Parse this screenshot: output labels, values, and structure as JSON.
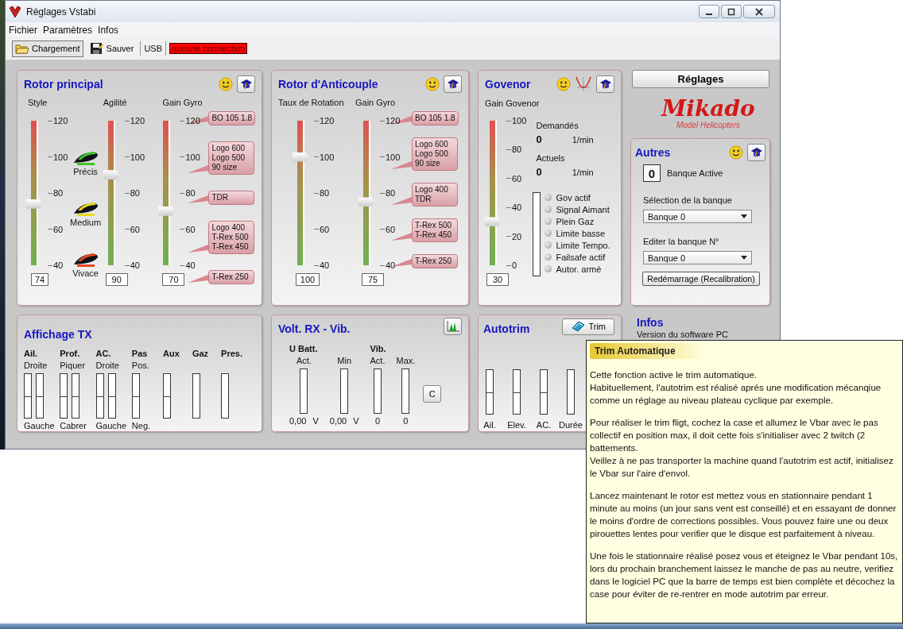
{
  "window": {
    "title": "Réglages Vstabi"
  },
  "menu": [
    {
      "label": "Fichier"
    },
    {
      "label": "Paramètres"
    },
    {
      "label": "Infos"
    }
  ],
  "toolbar": {
    "buttons": [
      {
        "label": "Chargement",
        "kind": "open",
        "pressed": true
      },
      {
        "label": "Sauver",
        "kind": "save",
        "pressed": false
      }
    ],
    "port": "USB",
    "connection": "aucune connection"
  },
  "rotor_principal": {
    "title": "Rotor principal",
    "sliders": [
      {
        "label": "Style",
        "ticks": [
          "120",
          "100",
          "80",
          "60",
          "40"
        ],
        "level": 0.425,
        "reading": "74",
        "styles": [
          {
            "label": "Précis",
            "color": "#3cc828"
          },
          {
            "label": "Medium",
            "color": "#e8d820"
          },
          {
            "label": "Vivace",
            "color": "#e84820"
          }
        ]
      },
      {
        "label": "Agilité",
        "ticks": [
          "120",
          "100",
          "80",
          "60",
          "40"
        ],
        "level": 0.625,
        "reading": "90"
      },
      {
        "label": "Gain Gyro",
        "ticks": [
          "120",
          "100",
          "80",
          "60",
          "40"
        ],
        "level": 0.375,
        "reading": "70",
        "tags": [
          "BO 105 1.8",
          "Logo 600\nLogo 500\n90 size",
          "TDR",
          "Logo 400\nT-Rex 500\nT-Rex 450",
          "T-Rex 250"
        ]
      }
    ]
  },
  "rotor_anticouple": {
    "title": "Rotor d'Anticouple",
    "sliders": [
      {
        "label": "Taux de Rotation",
        "ticks": [
          "120",
          "100",
          "80",
          "60",
          "40"
        ],
        "level": 0.75,
        "reading": "100"
      },
      {
        "label": "Gain Gyro",
        "ticks": [
          "120",
          "100",
          "80",
          "60",
          "40"
        ],
        "level": 0.4375,
        "reading": "75",
        "tags": [
          "BO 105 1.8",
          "Logo 600\nLogo 500\n90 size",
          "Logo 400\nTDR",
          "T-Rex 500\nT-Rex 450",
          "T-Rex 250"
        ]
      }
    ]
  },
  "govenor": {
    "title": "Govenor",
    "slider": {
      "label": "Gain Govenor",
      "ticks": [
        "100",
        "80",
        "60",
        "40",
        "20",
        "0"
      ],
      "level": 0.3,
      "reading": "30"
    },
    "readouts": [
      {
        "label": "Demandés",
        "value": "0",
        "unit": "1/min"
      },
      {
        "label": "Actuels",
        "value": "0",
        "unit": "1/min"
      }
    ],
    "status_meter": {
      "level": 0
    },
    "indicators": [
      {
        "label": "Gov actif",
        "on": false
      },
      {
        "label": "Signal Aimant",
        "on": false
      },
      {
        "label": "Plein Gaz",
        "on": false
      },
      {
        "label": "Limite basse",
        "on": false
      },
      {
        "label": "Limite Tempo.",
        "on": false
      },
      {
        "label": "Failsafe actif",
        "on": false
      },
      {
        "label": "Autor. armé",
        "on": false
      }
    ]
  },
  "settings_button": "Réglages",
  "logo": {
    "name": "Mikado",
    "tagline": "Model Helicopters"
  },
  "autres": {
    "title": "Autres",
    "active_bank": {
      "value": "0",
      "label": "Banque Active"
    },
    "fields": [
      {
        "label": "Sélection de la banque",
        "value": "Banque 0"
      },
      {
        "label": "Editer la banque N°",
        "value": "Banque 0"
      }
    ],
    "button": "Redémarrage (Recalibration)"
  },
  "affichage_tx": {
    "title": "Affichage TX",
    "channels": [
      {
        "name": "Ail.",
        "top": "Droite",
        "bottom": "Gauche",
        "bars": [
          {
            "level": 0.5
          },
          {
            "level": 0.5
          }
        ]
      },
      {
        "name": "Prof.",
        "top": "Piquer",
        "bottom": "Cabrer",
        "bars": [
          {
            "level": 0.5
          },
          {
            "level": 0.5
          }
        ]
      },
      {
        "name": "AC.",
        "top": "Droite",
        "bottom": "Gauche",
        "bars": [
          {
            "level": 0.5
          },
          {
            "level": 0.5
          }
        ]
      },
      {
        "name": "Pas",
        "top": "Pos.",
        "bottom": "Neg.",
        "bars": [
          {
            "level": 0.5
          }
        ]
      },
      {
        "name": "Aux",
        "bars": [
          {
            "level": 0.5
          }
        ]
      },
      {
        "name": "Gaz",
        "bars": [
          {
            "level": 0
          }
        ]
      },
      {
        "name": "Pres.",
        "bars": [
          {
            "level": 0
          }
        ]
      }
    ]
  },
  "volt_rx": {
    "title": "Volt. RX - Vib.",
    "groups": [
      {
        "name": "U Batt.",
        "meters": [
          {
            "label": "Act.",
            "level": 0,
            "reading": "0,00",
            "unit": "V"
          },
          {
            "label": "Min",
            "level": 0,
            "reading": "0,00",
            "unit": "V"
          }
        ]
      },
      {
        "name": "Vib.",
        "meters": [
          {
            "label": "Act.",
            "level": 0,
            "reading": "0"
          },
          {
            "label": "Max.",
            "level": 0,
            "reading": "0"
          }
        ]
      }
    ],
    "reset_button": "C"
  },
  "autotrim": {
    "title": "Autotrim",
    "trim_button": "Trim",
    "bars": [
      {
        "label": "Ail.",
        "kind": "center",
        "level": 0.5
      },
      {
        "label": "Elev.",
        "kind": "center",
        "level": 0.5
      },
      {
        "label": "AC.",
        "kind": "center",
        "level": 0.5
      },
      {
        "label": "Durée",
        "kind": "fill",
        "level": 0
      }
    ]
  },
  "infos": {
    "title": "Infos",
    "lines": [
      "Version du software PC"
    ]
  },
  "tooltip": {
    "title": "Trim Automatique",
    "paragraphs": [
      "Cette fonction active le trim automatique.\nHabituellement, l'autotrim est réalisé aprés une modification mécanqiue comme un réglage au niveau plateau cyclique par exemple.",
      "Pour réaliser le trim fligt, cochez la case et allumez le Vbar avec le pas collectif en position max, il doit cette fois s'initialiser avec 2 twitch (2 battements.\nVeillez à ne pas transporter la machine quand l'autotrim est actif, initialisez le Vbar sur l'aire d'envol.",
      "Lancez maintenant le rotor est mettez vous en stationnaire pendant 1 minute au moins (un jour sans vent est conseillé) et en essayant de donner le moins d'ordre de corrections possibles. Vous pouvez faire une ou deux pirouettes lentes pour verifier que le disque est parfaitement à niveau.",
      "Une fois le stationnaire réalisé posez vous et éteignez le Vbar pendant 10s, lors du prochain branchement laissez le manche de pas au neutre, verifiez dans le logiciel PC que la barre de temps est bien complète et décochez la case pour éviter de re-rentrer en mode autotrim par erreur."
    ]
  }
}
